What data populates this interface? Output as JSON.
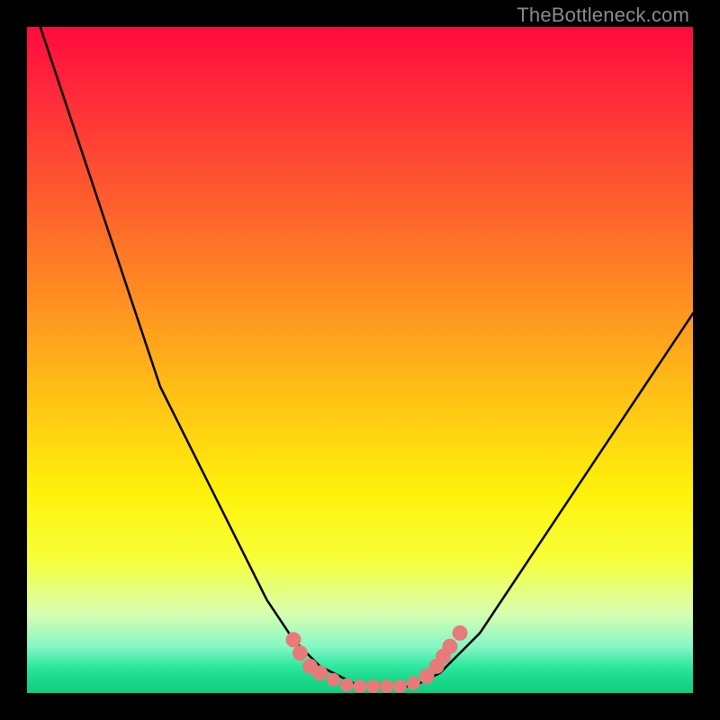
{
  "watermark": "TheBottleneck.com",
  "colors": {
    "frame": "#000000",
    "curve": "#000000",
    "dots": "#e97a7a",
    "gradient_stops": [
      "#ff0b3e",
      "#ff5a2e",
      "#ffc016",
      "#fff20a",
      "#2ee8a0",
      "#0fd17e"
    ]
  },
  "chart_data": {
    "type": "line",
    "title": "",
    "xlabel": "",
    "ylabel": "",
    "xlim": [
      0,
      100
    ],
    "ylim": [
      0,
      100
    ],
    "grid": false,
    "legend": false,
    "x": [
      0,
      2,
      4,
      6,
      8,
      10,
      12,
      14,
      16,
      18,
      20,
      22,
      24,
      26,
      28,
      30,
      32,
      34,
      36,
      38,
      40,
      42,
      44,
      46,
      48,
      50,
      52,
      54,
      56,
      58,
      60,
      62,
      64,
      66,
      68,
      70,
      72,
      74,
      76,
      78,
      80,
      82,
      84,
      86,
      88,
      90,
      92,
      94,
      96,
      98,
      100
    ],
    "y": [
      108,
      100,
      94,
      88,
      82,
      76,
      70,
      64,
      58,
      52,
      46,
      42,
      38,
      34,
      30,
      26,
      22,
      18,
      14,
      11,
      8,
      6,
      4,
      3,
      2,
      1,
      1,
      1,
      1,
      1,
      2,
      3,
      5,
      7,
      9,
      12,
      15,
      18,
      21,
      24,
      27,
      30,
      33,
      36,
      39,
      42,
      45,
      48,
      51,
      54,
      57
    ],
    "description": "Single black V-shaped curve over a vertical rainbow (red→green) gradient background; left branch starts above the visible top and descends steeply, flattens into a near-zero trough between x≈44 and x≈60, then the right branch rises roughly linearly to about y≈57 at x=100.",
    "markers": [
      {
        "x": 40,
        "y": 8
      },
      {
        "x": 41,
        "y": 6
      },
      {
        "x": 42.5,
        "y": 4
      },
      {
        "x": 44,
        "y": 3
      },
      {
        "x": 46,
        "y": 2
      },
      {
        "x": 48,
        "y": 1.2
      },
      {
        "x": 50,
        "y": 1
      },
      {
        "x": 52,
        "y": 1
      },
      {
        "x": 54,
        "y": 1
      },
      {
        "x": 56,
        "y": 1
      },
      {
        "x": 58,
        "y": 1.5
      },
      {
        "x": 60,
        "y": 2.5
      },
      {
        "x": 61.5,
        "y": 4
      },
      {
        "x": 62.5,
        "y": 5.5
      },
      {
        "x": 63.5,
        "y": 7
      },
      {
        "x": 65,
        "y": 9
      }
    ]
  }
}
